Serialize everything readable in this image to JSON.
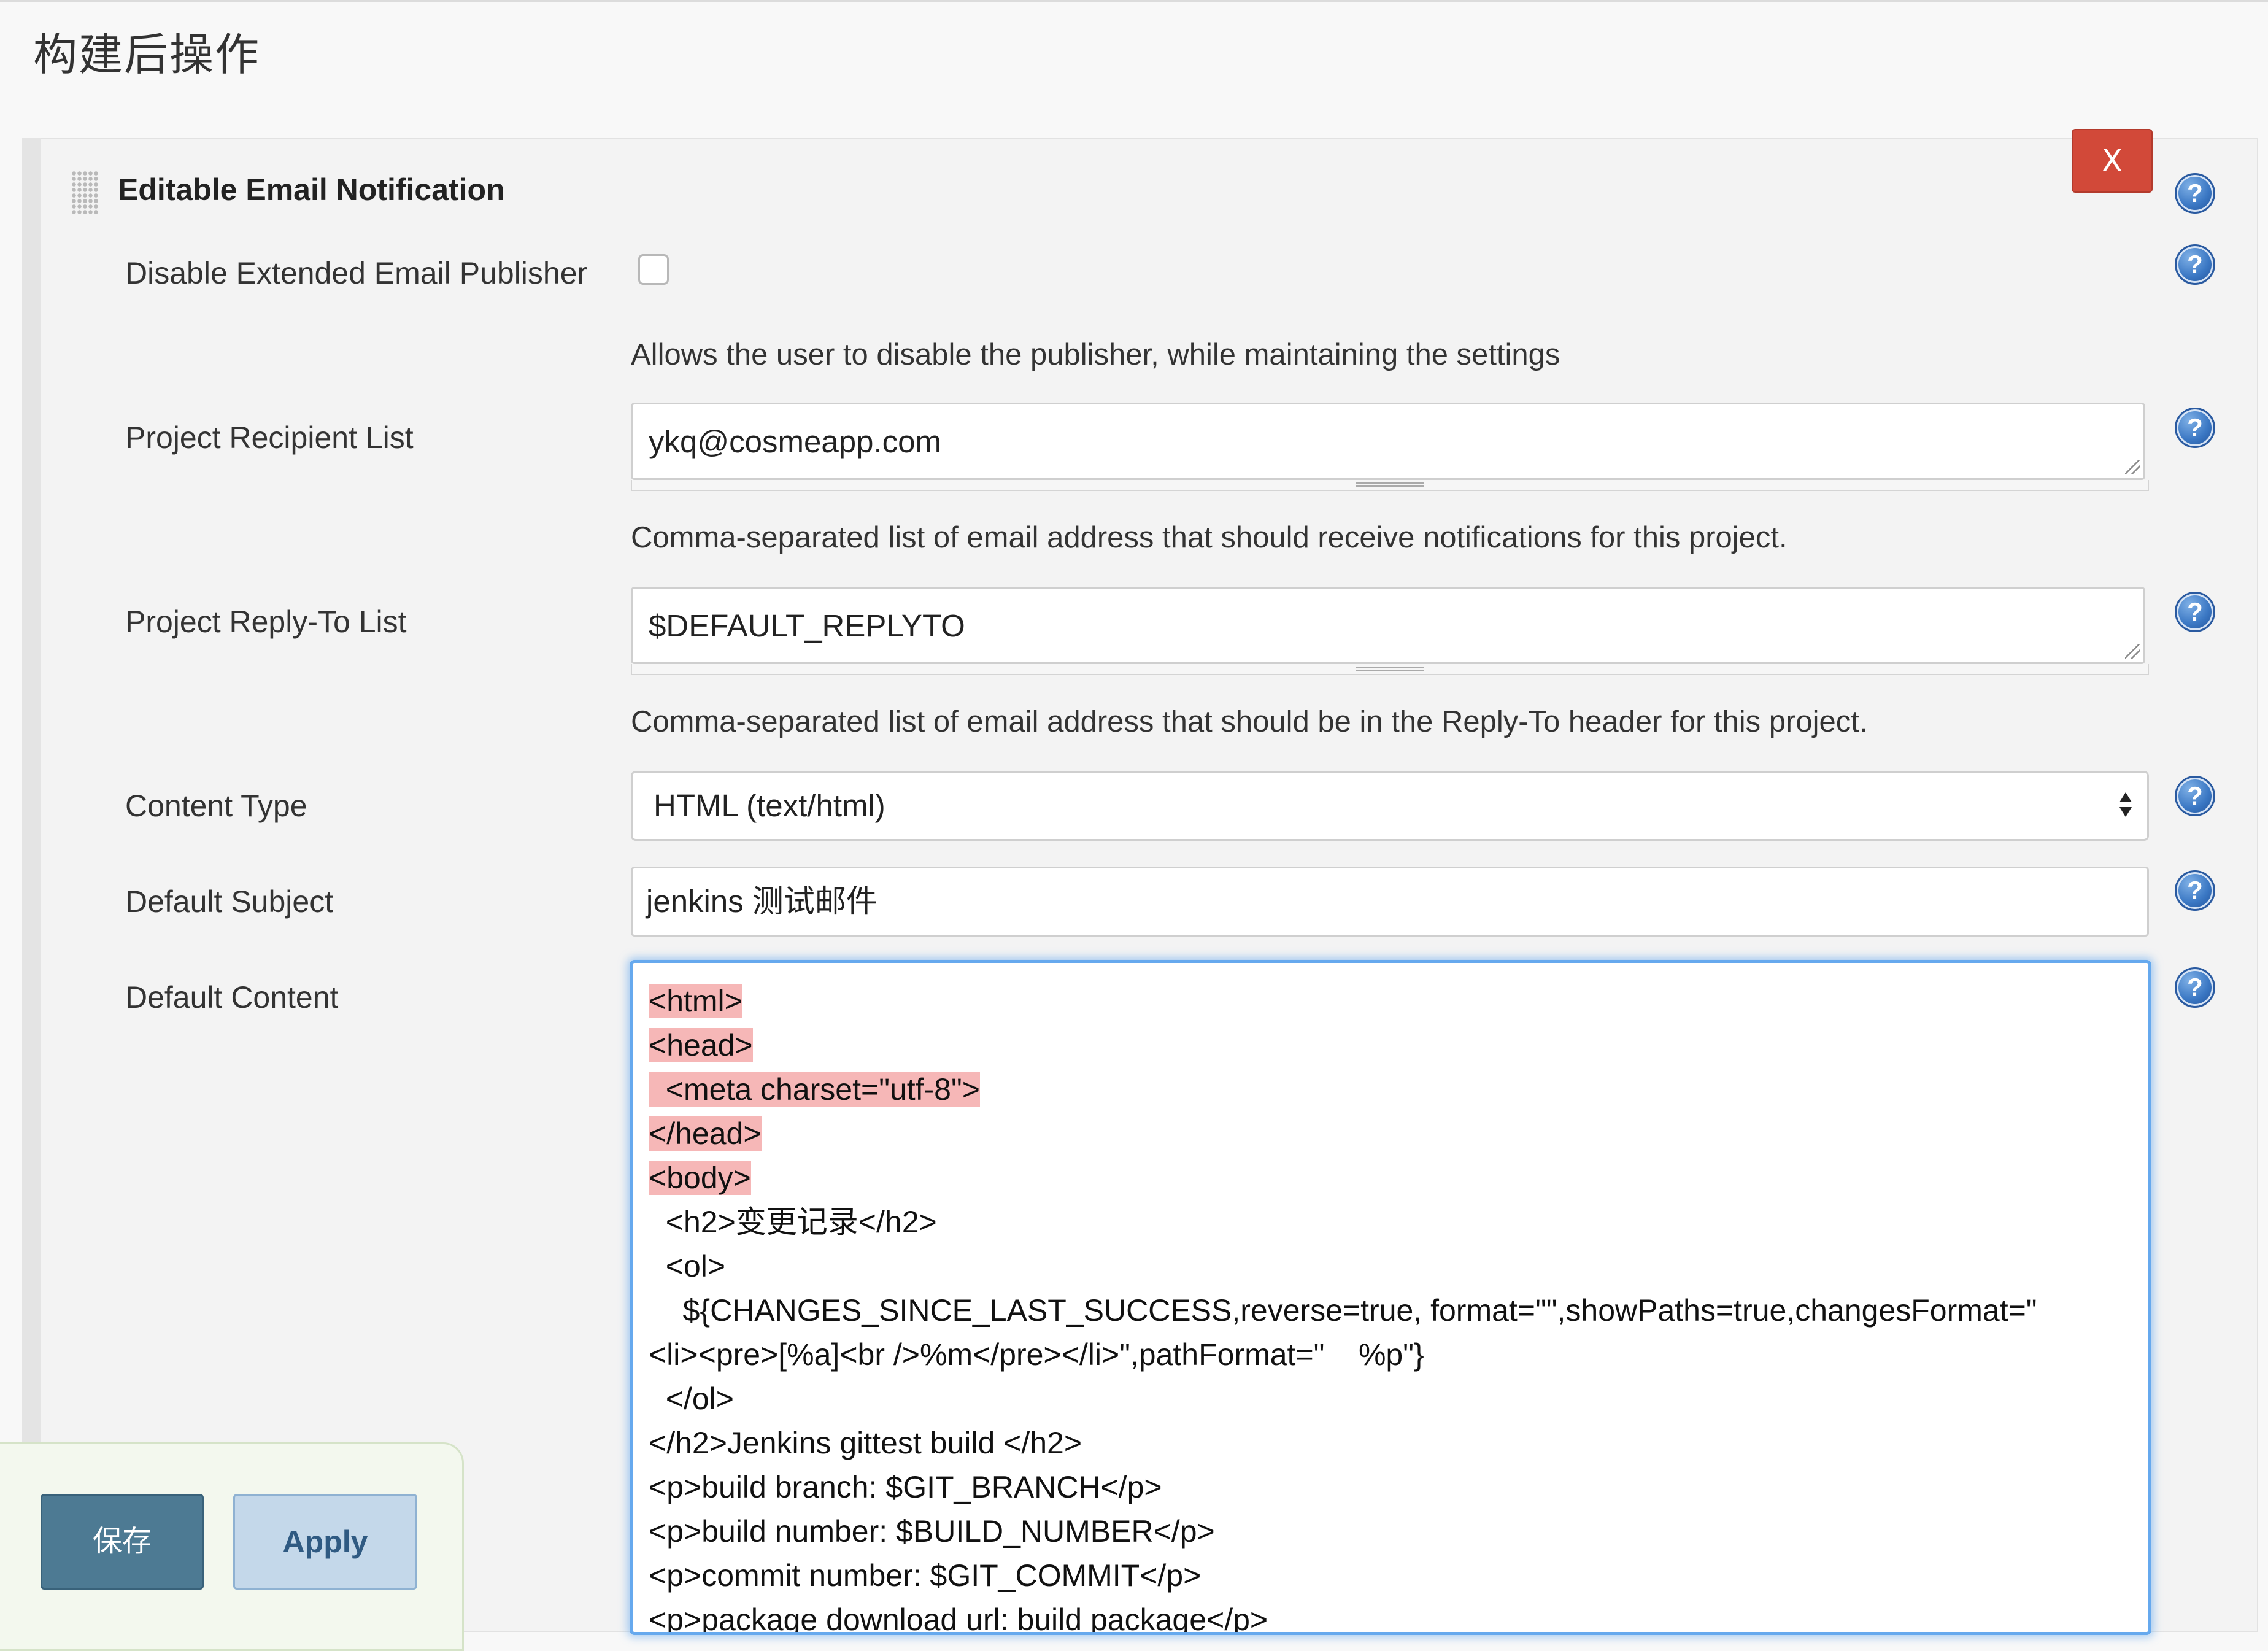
{
  "section": {
    "title": "构建后操作"
  },
  "panel": {
    "title": "Editable Email Notification",
    "close_label": "X"
  },
  "fields": {
    "disable_publisher": {
      "label": "Disable Extended Email Publisher",
      "checked": false,
      "description": "Allows the user to disable the publisher, while maintaining the settings"
    },
    "recipient_list": {
      "label": "Project Recipient List",
      "value": "ykq@cosmeapp.com",
      "description": "Comma-separated list of email address that should receive notifications for this project."
    },
    "reply_to_list": {
      "label": "Project Reply-To List",
      "value": "$DEFAULT_REPLYTO",
      "description": "Comma-separated list of email address that should be in the Reply-To header for this project."
    },
    "content_type": {
      "label": "Content Type",
      "selected": "HTML (text/html)"
    },
    "default_subject": {
      "label": "Default Subject",
      "value": "jenkins 测试邮件"
    },
    "default_content": {
      "label": "Default Content",
      "lines": [
        "<html>",
        "<head>",
        "  <meta charset=\"utf-8\">",
        "</head>",
        "<body>",
        "  <h2>变更记录</h2>",
        "  <ol>",
        "    ${CHANGES_SINCE_LAST_SUCCESS,reverse=true, format=\"\",showPaths=true,changesFormat=\"",
        "<li><pre>[%a]<br />%m</pre></li>\",pathFormat=\"    %p\"}",
        "  </ol>",
        "</h2>Jenkins gittest build </h2>",
        "<p>build branch: $GIT_BRANCH</p>",
        "<p>build number: $BUILD_NUMBER</p>",
        "<p>commit number: $GIT_COMMIT</p>",
        "<p>package download url: build package</p>"
      ]
    }
  },
  "help_icon_glyph": "?",
  "buttons": {
    "save_label": "保存",
    "apply_label": "Apply"
  },
  "colors": {
    "close_button": "#d24939",
    "save_button": "#4d7a93",
    "apply_button": "#c4d8ea",
    "focus_border": "#66a9ee",
    "code_highlight": "#f6b7b7"
  }
}
